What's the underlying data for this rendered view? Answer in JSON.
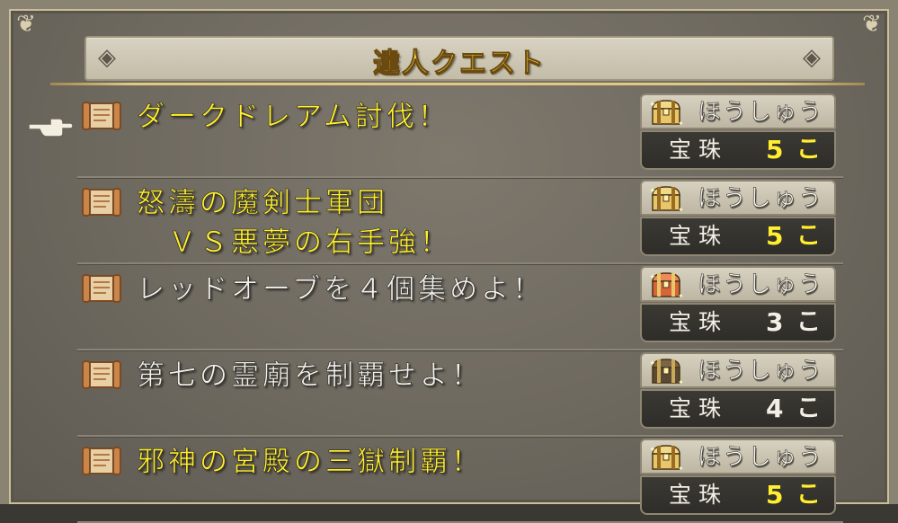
{
  "title": "達人クエスト",
  "colors": {
    "gold_text": "#ffef2e",
    "white_text": "#f3f1ec",
    "panel": "#6e695f"
  },
  "quests": [
    {
      "title": "ダークドレアム討伐！",
      "highlight": true,
      "reward_label": "ほうしゅう",
      "reward_item": "宝珠",
      "reward_count": "5",
      "reward_unit": "こ",
      "chest": "gold-chest-icon"
    },
    {
      "title": "怒濤の魔剣士軍団\n　ＶＳ悪夢の右手強！",
      "highlight": true,
      "reward_label": "ほうしゅう",
      "reward_item": "宝珠",
      "reward_count": "5",
      "reward_unit": "こ",
      "chest": "gold-chest-icon"
    },
    {
      "title": "レッドオーブを４個集めよ！",
      "highlight": false,
      "reward_label": "ほうしゅう",
      "reward_item": "宝珠",
      "reward_count": "3",
      "reward_unit": "こ",
      "chest": "red-chest-icon"
    },
    {
      "title": "第七の霊廟を制覇せよ！",
      "highlight": false,
      "reward_label": "ほうしゅう",
      "reward_item": "宝珠",
      "reward_count": "4",
      "reward_unit": "こ",
      "chest": "dark-chest-icon"
    },
    {
      "title": "邪神の宮殿の三獄制覇！",
      "highlight": true,
      "reward_label": "ほうしゅう",
      "reward_item": "宝珠",
      "reward_count": "5",
      "reward_unit": "こ",
      "chest": "gold-chest-icon"
    }
  ]
}
